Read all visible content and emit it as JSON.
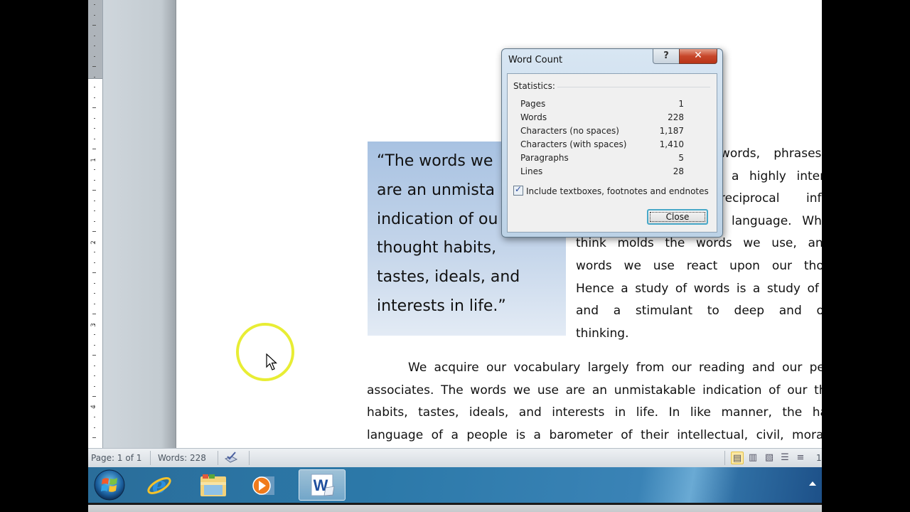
{
  "document": {
    "quote": "“The words we use are an unmistakable indication of our thought habits, tastes, ideals, and interests in life.”",
    "quote_lines": [
      "“The words we",
      "are an unmista",
      "indication of ou",
      "thought habits,",
      "tastes, ideals, and",
      "interests in life.”"
    ],
    "side_paragraph_lines": [
      "words, phrases, and",
      "a highly interesting",
      "reciprocal influence",
      "language. What we",
      "think molds the words we use, and the",
      "words we use react upon our thoughts.",
      "Hence a study of words is a study of ideas,",
      "and a stimulant to deep and original",
      "thinking."
    ],
    "paragraph2_lines": [
      "We acquire our vocabulary largely from our reading and our personal",
      "associates. The words we use are an unmistakable indication of our thought",
      "habits, tastes, ideals, and interests in life. In like manner, the habitual",
      "language of a people is a barometer of their intellectual, civil, moral, and"
    ]
  },
  "ruler": {
    "numbers": [
      "1",
      "2",
      "3",
      "4"
    ]
  },
  "dialog": {
    "title": "Word Count",
    "help_label": "?",
    "close_x_label": "✕",
    "statistics_label": "Statistics:",
    "stats": [
      {
        "label": "Pages",
        "value": "1"
      },
      {
        "label": "Words",
        "value": "228"
      },
      {
        "label": "Characters (no spaces)",
        "value": "1,187"
      },
      {
        "label": "Characters (with spaces)",
        "value": "1,410"
      },
      {
        "label": "Paragraphs",
        "value": "5"
      },
      {
        "label": "Lines",
        "value": "28"
      }
    ],
    "include_label": "Include textboxes, footnotes and endnotes",
    "include_checked": true,
    "checkmark": "✓",
    "close_button_label": "Close"
  },
  "statusbar": {
    "page": "Page: 1 of 1",
    "words": "Words: 228",
    "proofing_icon": "proofing-check-icon",
    "zoom_partial": "1",
    "views": [
      {
        "name": "print-layout",
        "glyph": "▤",
        "active": true
      },
      {
        "name": "full-screen-reading",
        "glyph": "▥",
        "active": false
      },
      {
        "name": "web-layout",
        "glyph": "▧",
        "active": false
      },
      {
        "name": "outline",
        "glyph": "☰",
        "active": false
      },
      {
        "name": "draft",
        "glyph": "≡",
        "active": false
      }
    ]
  },
  "taskbar": {
    "items": [
      {
        "name": "start-button",
        "icon": "windows-logo-icon"
      },
      {
        "name": "internet-explorer",
        "icon": "ie-icon"
      },
      {
        "name": "windows-explorer",
        "icon": "folder-icon"
      },
      {
        "name": "media-player",
        "icon": "media-player-icon"
      },
      {
        "name": "microsoft-word",
        "icon": "word-icon",
        "active": true
      }
    ]
  }
}
